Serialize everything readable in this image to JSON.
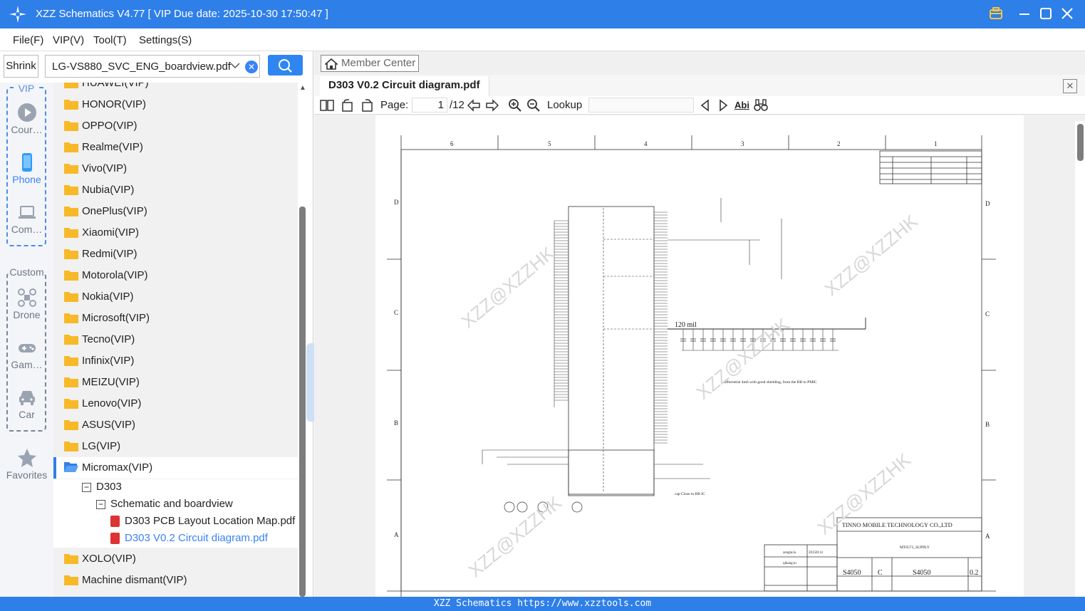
{
  "window": {
    "title": "XZZ Schematics V4.77 [ VIP Due date: 2025-10-30 17:50:47 ]"
  },
  "menu": {
    "items": [
      "File(F)",
      "VIP(V)",
      "Tool(T)",
      "Settings(S)"
    ]
  },
  "toolbar_left": {
    "shrink_label": "Shrink",
    "file_value": "LG-VS880_SVC_ENG_boardview.pdf",
    "clear_symbol": "✕"
  },
  "categories": {
    "vip_label": "VIP",
    "custom_label": "Custom",
    "items": [
      {
        "label": "Cour…",
        "icon": "play-icon"
      },
      {
        "label": "Phone",
        "icon": "phone-icon"
      },
      {
        "label": "Com…",
        "icon": "laptop-icon"
      },
      {
        "label": "Drone",
        "icon": "drone-icon"
      },
      {
        "label": "Gam…",
        "icon": "gamepad-icon"
      },
      {
        "label": "Car",
        "icon": "car-icon"
      },
      {
        "label": "Favorites",
        "icon": "star-icon"
      }
    ],
    "active": "Phone"
  },
  "tree": {
    "folders": [
      "HUAWEI(VIP)",
      "HONOR(VIP)",
      "OPPO(VIP)",
      "Realme(VIP)",
      "Vivo(VIP)",
      "Nubia(VIP)",
      "OnePlus(VIP)",
      "Xiaomi(VIP)",
      "Redmi(VIP)",
      "Motorola(VIP)",
      "Nokia(VIP)",
      "Microsoft(VIP)",
      "Tecno(VIP)",
      "Infinix(VIP)",
      "MEIZU(VIP)",
      "Lenovo(VIP)",
      "ASUS(VIP)",
      "LG(VIP)",
      "Micromax(VIP)"
    ],
    "selected": "Micromax(VIP)",
    "sub_model": "D303",
    "sub_group": "Schematic and boardview",
    "files": [
      "D303 PCB Layout Location Map.pdf",
      "D303 V0.2 Circuit diagram.pdf"
    ],
    "folders_after": [
      "XOLO(VIP)",
      "Machine dismant(VIP)"
    ],
    "expand_symbol": "−"
  },
  "viewer": {
    "member_center": "Member Center",
    "tab_title": "D303 V0.2 Circuit diagram.pdf",
    "page_label": "Page:",
    "page_current": "1",
    "page_total": "/12",
    "lookup_label": "Lookup",
    "abi": "Abi"
  },
  "schematic": {
    "col_labels": [
      "6",
      "5",
      "4",
      "3",
      "2",
      "1"
    ],
    "row_labels": [
      "D",
      "C",
      "B",
      "A"
    ],
    "company": "TINNO MOBILE TECHNOLOGY CO.,LTD",
    "title_text": "MT6572_SUPPLY",
    "size_code": "S4050",
    "size": "C",
    "drawing_no": "S4050",
    "rev": "0.2",
    "drawn_by": "zengla.lu",
    "date": "20150114",
    "checked_by": "qihang.lu",
    "label_120mil": "120 mil",
    "watermark": "XZZ@XZZHK",
    "diff_note": "differential 4mil with good shielding, from the BB to PMIC",
    "cap_note": "cap Close to BB IC"
  },
  "status": {
    "text": "XZZ Schematics https://www.xzztools.com"
  },
  "colors": {
    "accent": "#2f7fe8",
    "folder": "#f7b928",
    "pdf": "#d33333"
  }
}
